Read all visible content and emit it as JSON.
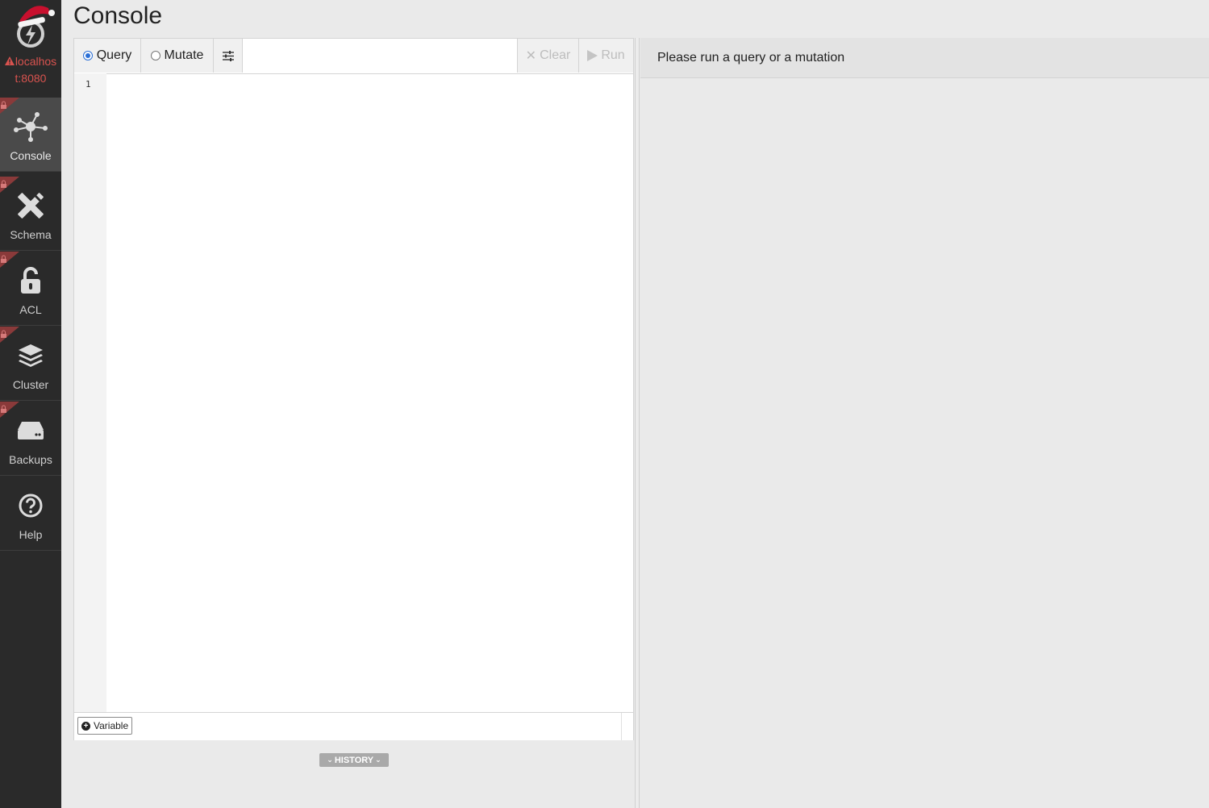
{
  "sidebar": {
    "server_line1": "localhos",
    "server_line2": "t:8080",
    "items": [
      {
        "label": "Console",
        "icon": "graph-nodes-icon",
        "active": true
      },
      {
        "label": "Schema",
        "icon": "pencil-ruler-icon",
        "active": false
      },
      {
        "label": "ACL",
        "icon": "unlock-icon",
        "active": false
      },
      {
        "label": "Cluster",
        "icon": "layers-icon",
        "active": false
      },
      {
        "label": "Backups",
        "icon": "hard-drive-icon",
        "active": false
      },
      {
        "label": "Help",
        "icon": "question-circle-icon",
        "active": false
      }
    ]
  },
  "page": {
    "title": "Console"
  },
  "toolbar": {
    "query_label": "Query",
    "mutate_label": "Mutate",
    "clear_label": "Clear",
    "run_label": "Run",
    "selected_mode": "Query"
  },
  "editor": {
    "line_numbers": [
      "1"
    ],
    "content": ""
  },
  "variable_button": {
    "label": "Variable"
  },
  "history_button": {
    "label": "HISTORY"
  },
  "result": {
    "message": "Please run a query or a mutation"
  },
  "colors": {
    "accent": "#2b6fd6",
    "sidebar_bg": "#2a2a2a",
    "warning": "#d9534f",
    "santa_hat": "#c8102e"
  }
}
